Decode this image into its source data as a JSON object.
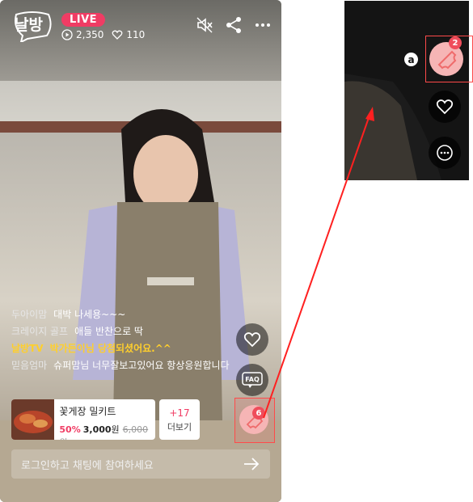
{
  "header": {
    "logo_text": "날방",
    "live_badge": "LIVE",
    "view_count": "2,350",
    "like_count": "110",
    "icons": [
      "mute-icon",
      "share-icon",
      "more-icon"
    ]
  },
  "chat": [
    {
      "user": "두아이맘",
      "msg": "대박 나세용~~~",
      "highlight": false
    },
    {
      "user": "크레이지 골프",
      "msg": "애들 반찬으로 딱",
      "highlight": false
    },
    {
      "user": "날방TV",
      "msg": "박가든이님 당첨되셨어요.^^",
      "highlight": true
    },
    {
      "user": "믿음엄마",
      "msg": "슈퍼맘님 너무잘보고있어요 항상응원합니다",
      "highlight": false
    }
  ],
  "product": {
    "name": "꽃게장 밀키트",
    "discount": "50%",
    "price": "3,000",
    "unit": "원",
    "original_price": "6,000원"
  },
  "more": {
    "count": "+17",
    "label": "더보기"
  },
  "side": {
    "coupon_count": "6"
  },
  "input": {
    "placeholder": "로그인하고 채팅에 참여하세요"
  },
  "zoom": {
    "marker": "a",
    "coupon_count": "2"
  },
  "colors": {
    "accent": "#f03c64",
    "highlight": "#ffcf2c",
    "annotation": "#ff2a2a"
  }
}
